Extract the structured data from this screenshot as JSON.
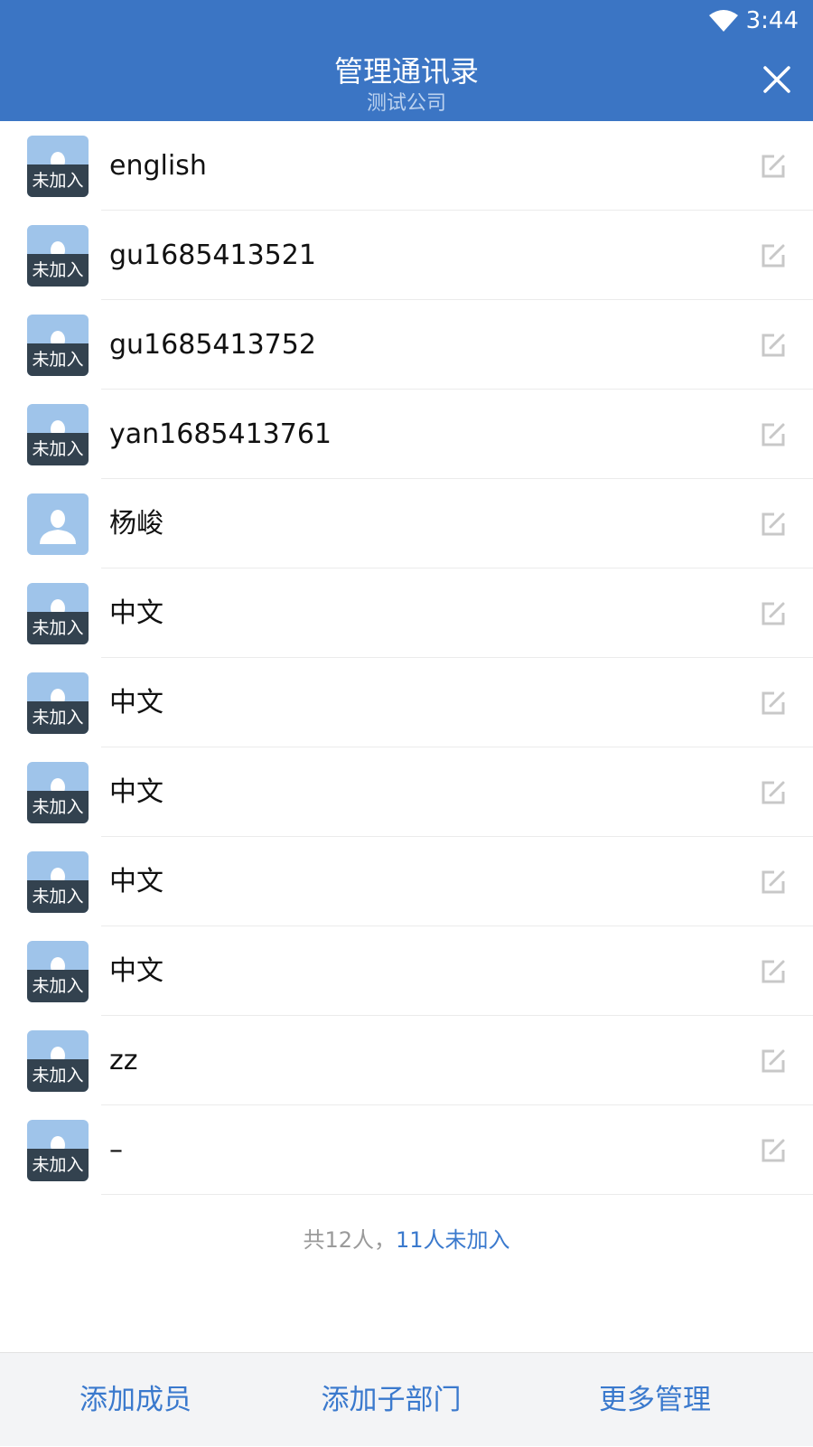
{
  "status_bar": {
    "time": "3:44",
    "wifi_icon": "wifi-icon"
  },
  "header": {
    "title": "管理通讯录",
    "subtitle": "测试公司",
    "close_icon": "close-icon"
  },
  "members": [
    {
      "name": "english",
      "badge": "未加入",
      "joined": false
    },
    {
      "name": "gu1685413521",
      "badge": "未加入",
      "joined": false
    },
    {
      "name": "gu1685413752",
      "badge": "未加入",
      "joined": false
    },
    {
      "name": "yan1685413761",
      "badge": "未加入",
      "joined": false
    },
    {
      "name": "杨峻",
      "badge": "",
      "joined": true
    },
    {
      "name": "中文",
      "badge": "未加入",
      "joined": false
    },
    {
      "name": "中文",
      "badge": "未加入",
      "joined": false
    },
    {
      "name": "中文",
      "badge": "未加入",
      "joined": false
    },
    {
      "name": "中文",
      "badge": "未加入",
      "joined": false
    },
    {
      "name": "中文",
      "badge": "未加入",
      "joined": false
    },
    {
      "name": "zz",
      "badge": "未加入",
      "joined": false
    },
    {
      "name": "–",
      "badge": "未加入",
      "joined": false
    }
  ],
  "summary": {
    "total": "共12人，",
    "pending": "11人未加入"
  },
  "bottom_bar": {
    "add_member": "添加成员",
    "add_subdept": "添加子部门",
    "more_manage": "更多管理"
  },
  "colors": {
    "header_bg": "#3b75c4",
    "accent": "#3a79cd",
    "avatar_bg": "#9fc4ea",
    "badge_bg": "#33424f"
  }
}
